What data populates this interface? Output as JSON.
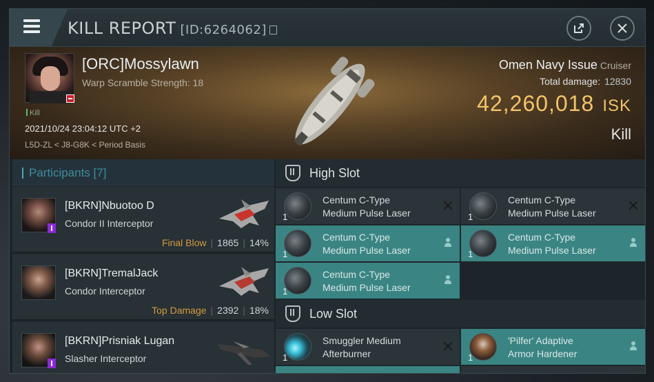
{
  "header": {
    "title": "KILL REPORT",
    "id_label": "[ID:6264062]"
  },
  "victim": {
    "name": "[ORC]Mossylawn",
    "warp_scramble": "Warp Scramble Strength: 18",
    "kill_tag": "Kill",
    "datetime": "2021/10/24 23:04:12 UTC +2",
    "location": "L5D-ZL < J8-G8K < Period Basis",
    "ship_name": "Omen Navy Issue",
    "ship_class": "Cruiser",
    "total_damage_label": "Total damage:",
    "total_damage": "12830",
    "isk_value": "42,260,018",
    "isk_unit": "ISK",
    "result": "Kill"
  },
  "participants": {
    "header": "Participants [7]",
    "list": [
      {
        "name": "[BKRN]Nbuotoo D",
        "ship": "Condor II Interceptor",
        "tag": "Final Blow",
        "damage": "1865",
        "percent": "14%"
      },
      {
        "name": "[BKRN]TremalJack",
        "ship": "Condor Interceptor",
        "tag": "Top Damage",
        "damage": "2392",
        "percent": "18%"
      },
      {
        "name": "[BKRN]Prisniak Lugan",
        "ship": "Slasher Interceptor",
        "tag": "",
        "damage": "",
        "percent": ""
      }
    ]
  },
  "fitting": {
    "high_slot_label": "High Slot",
    "low_slot_label": "Low Slot",
    "high_items": [
      {
        "qty": "1",
        "line1": "Centum C-Type",
        "line2": "Medium Pulse Laser",
        "status": "destroyed"
      },
      {
        "qty": "1",
        "line1": "Centum C-Type",
        "line2": "Medium Pulse Laser",
        "status": "destroyed"
      },
      {
        "qty": "1",
        "line1": "Centum C-Type",
        "line2": "Medium Pulse Laser",
        "status": "dropped"
      },
      {
        "qty": "1",
        "line1": "Centum C-Type",
        "line2": "Medium Pulse Laser",
        "status": "dropped"
      },
      {
        "qty": "1",
        "line1": "Centum C-Type",
        "line2": "Medium Pulse Laser",
        "status": "dropped"
      }
    ],
    "low_items": [
      {
        "qty": "1",
        "line1": "Smuggler Medium",
        "line2": "Afterburner",
        "status": "destroyed"
      },
      {
        "qty": "1",
        "line1": "'Pilfer' Adaptive",
        "line2": "Armor Hardener",
        "status": "dropped"
      }
    ]
  },
  "colors": {
    "isk": "#f2c46a",
    "accent_teal": "#3a8583",
    "final_blow": "#d59b3c"
  }
}
